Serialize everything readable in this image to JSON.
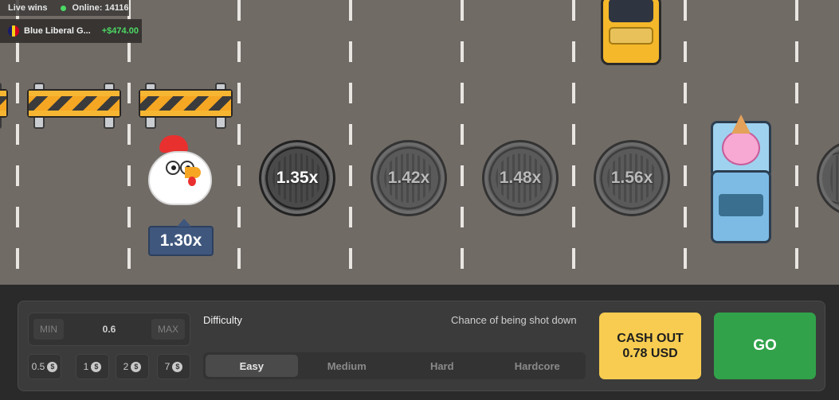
{
  "live": {
    "title": "Live wins",
    "online": "Online: 14116",
    "wins": [
      {
        "player": "Blue Liberal G...",
        "amount": "+$474.00"
      }
    ]
  },
  "game": {
    "current_multiplier": "1.30x",
    "manholes": [
      "1.35x",
      "1.42x",
      "1.48x",
      "1.56x"
    ],
    "partial_manhole": "1"
  },
  "bet": {
    "min_label": "MIN",
    "max_label": "MAX",
    "value": "0.6",
    "quick_amounts": [
      "0.5",
      "1",
      "2",
      "7"
    ],
    "currency_icon": "dollar-coin-icon"
  },
  "difficulty": {
    "label": "Difficulty",
    "chance_label": "Chance of being shot down",
    "options": [
      "Easy",
      "Medium",
      "Hard",
      "Hardcore"
    ],
    "selected": "Easy"
  },
  "actions": {
    "cashout_title": "CASH OUT",
    "cashout_amount": "0.78 USD",
    "go": "GO"
  },
  "colors": {
    "road": "#716b66",
    "cashout": "#f7cc50",
    "go": "#31a24a",
    "multiplier_badge": "#3f577d",
    "win_amount": "#4cd964"
  }
}
